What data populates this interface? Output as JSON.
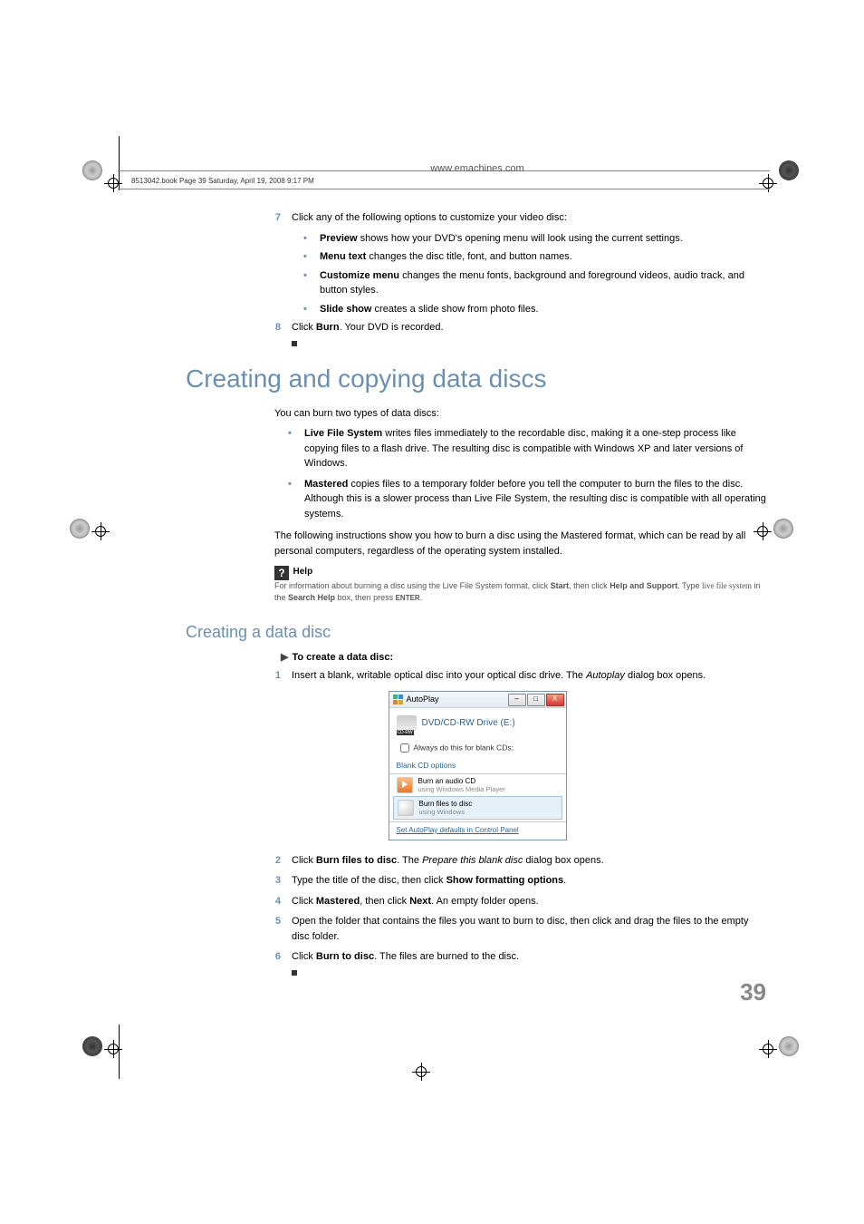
{
  "header": {
    "meta_line": "8513042.book  Page 39  Saturday, April 19, 2008  9:17 PM",
    "url": "www.emachines.com"
  },
  "step7": {
    "num": "7",
    "text": "Click any of the following options to customize your video disc:",
    "bullets": [
      {
        "bold": "Preview",
        "rest": " shows how your DVD's opening menu will look using the current settings."
      },
      {
        "bold": "Menu text",
        "rest": " changes the disc title, font, and button names."
      },
      {
        "bold": "Customize menu",
        "rest": " changes the menu fonts, background and foreground videos, audio track, and button styles."
      },
      {
        "bold": "Slide show",
        "rest": " creates a slide show from photo files."
      }
    ]
  },
  "step8": {
    "num": "8",
    "pre": "Click ",
    "bold": "Burn",
    "post": ". Your DVD is recorded."
  },
  "h1": "Creating and copying data discs",
  "intro1": "You can burn two types of data discs:",
  "type_bullets": [
    {
      "bold": "Live File System",
      "rest": " writes files immediately to the recordable disc, making it a one-step process like copying files to a flash drive. The resulting disc is compatible with Windows XP and later versions of Windows."
    },
    {
      "bold": "Mastered",
      "rest": " copies files to a temporary folder before you tell the computer to burn the files to the disc. Although this is a slower process than Live File System, the resulting disc is compatible with all operating systems."
    }
  ],
  "intro2": "The following instructions show you how to burn a disc using the Mastered format, which can be read by all personal computers, regardless of the operating system installed.",
  "help": {
    "title": "Help",
    "line1_a": "For information about burning a disc using the Live File System format, click ",
    "line1_b": "Start",
    "line1_c": ", then click ",
    "line1_d": "Help and Support",
    "line1_e": ". Type ",
    "line1_f": "live file system",
    "line1_g": " in the ",
    "line1_h": "Search Help",
    "line1_i": " box, then press ",
    "line1_j": "ENTER",
    "line1_k": "."
  },
  "h2": "Creating a data disc",
  "proc_header": "To create a data disc:",
  "psteps": {
    "s1": {
      "num": "1",
      "a": "Insert a blank, writable optical disc into your optical disc drive. The ",
      "i": "Autoplay",
      "b": " dialog box opens."
    },
    "s2": {
      "num": "2",
      "a": "Click ",
      "bold": "Burn files to disc",
      "b": ". The ",
      "i": "Prepare this blank disc",
      "c": " dialog box opens."
    },
    "s3": {
      "num": "3",
      "a": "Type the title of the disc, then click ",
      "bold": "Show formatting options",
      "b": "."
    },
    "s4": {
      "num": "4",
      "a": "Click ",
      "bold1": "Mastered",
      "b": ", then click ",
      "bold2": "Next",
      "c": ". An empty folder opens."
    },
    "s5": {
      "num": "5",
      "a": "Open the folder that contains the files you want to burn to disc, then click and drag the files to the empty disc folder."
    },
    "s6": {
      "num": "6",
      "a": "Click ",
      "bold": "Burn to disc",
      "b": ". The files are burned to the disc."
    }
  },
  "autoplay": {
    "title": "AutoPlay",
    "drive": "DVD/CD-RW Drive (E:)",
    "checkbox": "Always do this for blank CDs:",
    "section": "Blank CD options",
    "opt1": {
      "t": "Burn an audio CD",
      "s": "using Windows Media Player"
    },
    "opt2": {
      "t": "Burn files to disc",
      "s": "using Windows"
    },
    "link": "Set AutoPlay defaults in Control Panel"
  },
  "page_num": "39"
}
